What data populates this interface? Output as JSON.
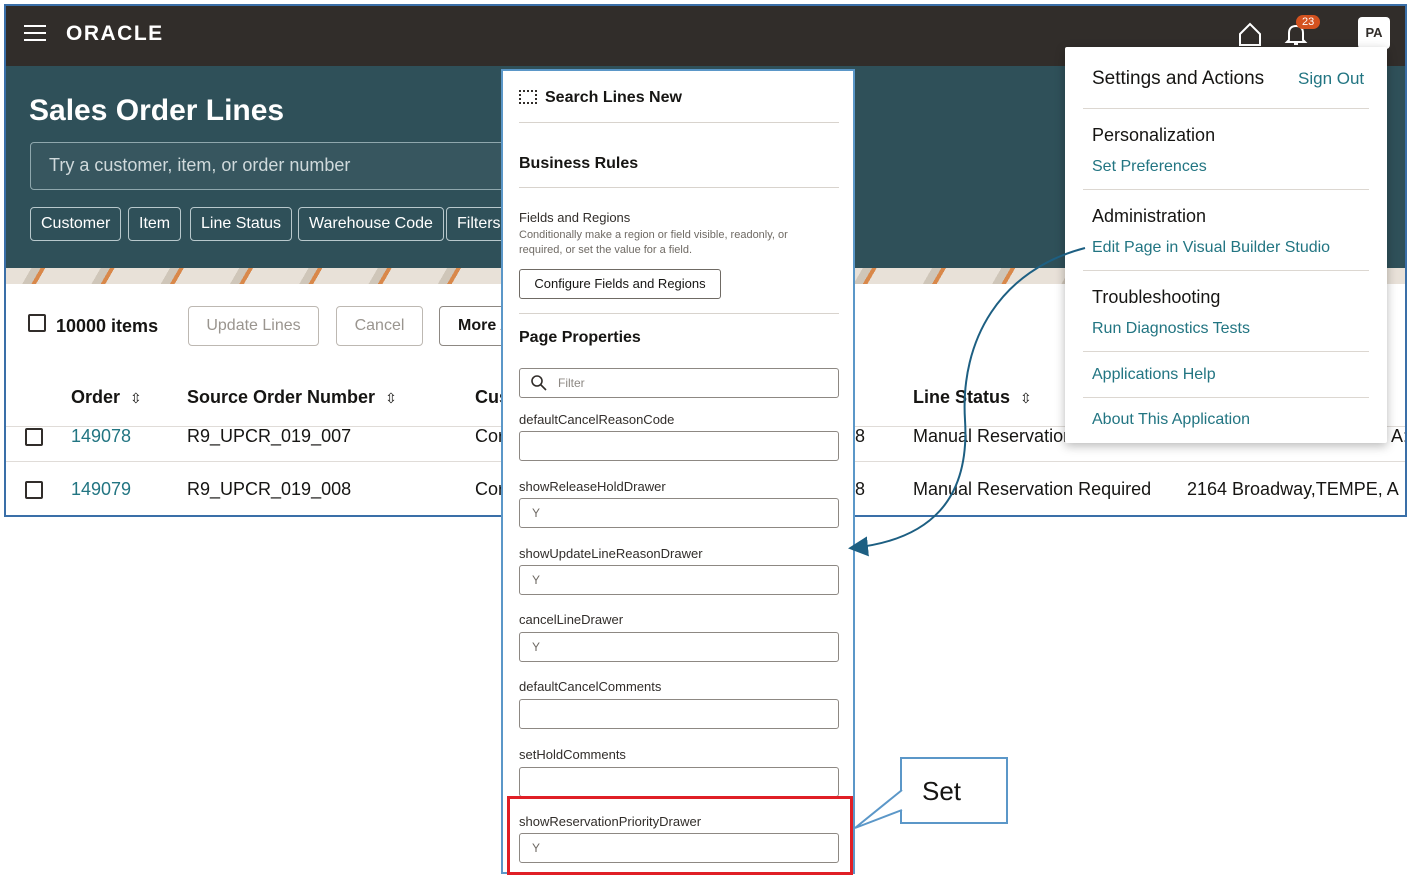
{
  "topbar": {
    "brand": "ORACLE",
    "notifications_count": "23",
    "user_initials": "PA"
  },
  "header": {
    "title": "Sales Order Lines",
    "search_placeholder": "Try a customer, item, or order number",
    "chips": [
      "Customer",
      "Item",
      "Line Status",
      "Warehouse Code",
      "Filters"
    ]
  },
  "toolbar": {
    "items_count": "10000 items",
    "update_lines": "Update Lines",
    "cancel": "Cancel",
    "more": "More A"
  },
  "table": {
    "columns": [
      "Order",
      "Source Order Number",
      "Cus",
      "Line Status"
    ],
    "rows": [
      {
        "order": "149078",
        "source": "R9_UPCR_019_007",
        "cust": "Cor",
        "partial": "8",
        "status": "Manual Reservation",
        "address": "A:"
      },
      {
        "order": "149079",
        "source": "R9_UPCR_019_008",
        "cust": "Cor",
        "partial": "8",
        "status": "Manual Reservation Required",
        "address": "2164 Broadway,TEMPE, A"
      }
    ]
  },
  "settings_menu": {
    "title": "Settings and Actions",
    "sign_out": "Sign Out",
    "sections": [
      {
        "heading": "Personalization",
        "links": [
          "Set Preferences"
        ]
      },
      {
        "heading": "Administration",
        "links": [
          "Edit Page in Visual Builder Studio"
        ]
      },
      {
        "heading": "Troubleshooting",
        "links": [
          "Run Diagnostics Tests"
        ]
      }
    ],
    "footer_links": [
      "Applications Help",
      "About This Application"
    ]
  },
  "panel": {
    "title": "Search Lines New",
    "business_rules": "Business Rules",
    "fields_regions_title": "Fields and Regions",
    "fields_regions_desc": "Conditionally make a region or field visible, readonly, or required, or set the value for a field.",
    "configure_button": "Configure Fields and Regions",
    "page_properties": "Page Properties",
    "filter_placeholder": "Filter",
    "properties": [
      {
        "name": "defaultCancelReasonCode",
        "value": ""
      },
      {
        "name": "showReleaseHoldDrawer",
        "value": "Y"
      },
      {
        "name": "showUpdateLineReasonDrawer",
        "value": "Y"
      },
      {
        "name": "cancelLineDrawer",
        "value": "Y"
      },
      {
        "name": "defaultCancelComments",
        "value": ""
      },
      {
        "name": "setHoldComments",
        "value": ""
      },
      {
        "name": "showReservationPriorityDrawer",
        "value": "Y"
      }
    ]
  },
  "callout": {
    "text": "Set"
  },
  "colors": {
    "topbar": "#312d2a",
    "hero": "#2f5059",
    "link": "#227582",
    "highlight": "#e01f26",
    "annotation": "#1d5f82"
  }
}
